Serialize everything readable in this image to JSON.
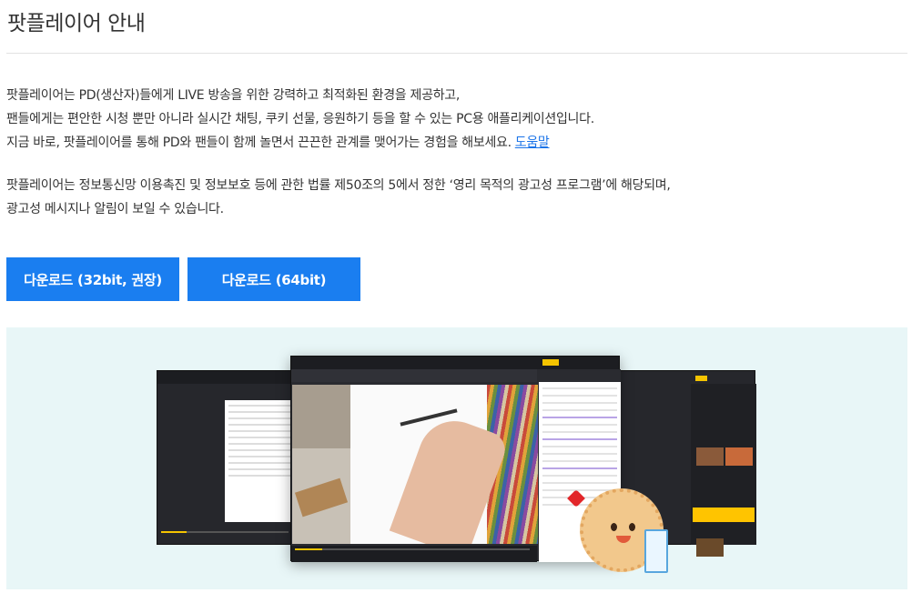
{
  "header": {
    "title": "팟플레이어 안내"
  },
  "intro": {
    "line1": "팟플레이어는 PD(생산자)들에게 LIVE 방송을 위한 강력하고 최적화된 환경을 제공하고,",
    "line2": "팬들에게는 편안한 시청 뿐만 아니라 실시간 채팅, 쿠키 선물, 응원하기 등을 할 수 있는 PC용 애플리케이션입니다.",
    "line3": "지금 바로, 팟플레이어를 통해 PD와 팬들이 함께 놀면서 끈끈한 관계를 맺어가는 경험을 해보세요.",
    "help_link": "도움말"
  },
  "notice": {
    "line1": "팟플레이어는 정보통신망 이용촉진 및 정보보호 등에 관한 법률 제50조의 5에서 정한 ‘영리 목적의 광고성 프로그램’에 해당되며,",
    "line2": "광고성 메시지나 알림이 보일 수 있습니다."
  },
  "downloads": {
    "bit32_label": "다운로드 (32bit, 권장)",
    "bit64_label": "다운로드 (64bit)"
  },
  "colors": {
    "accent": "#1a7ef0",
    "link": "#1a73e8",
    "showcase_bg": "#e8f6f7",
    "app_yellow": "#f5c400"
  },
  "icons": [
    "heart-icon",
    "cookie-mascot",
    "milk-glass"
  ]
}
